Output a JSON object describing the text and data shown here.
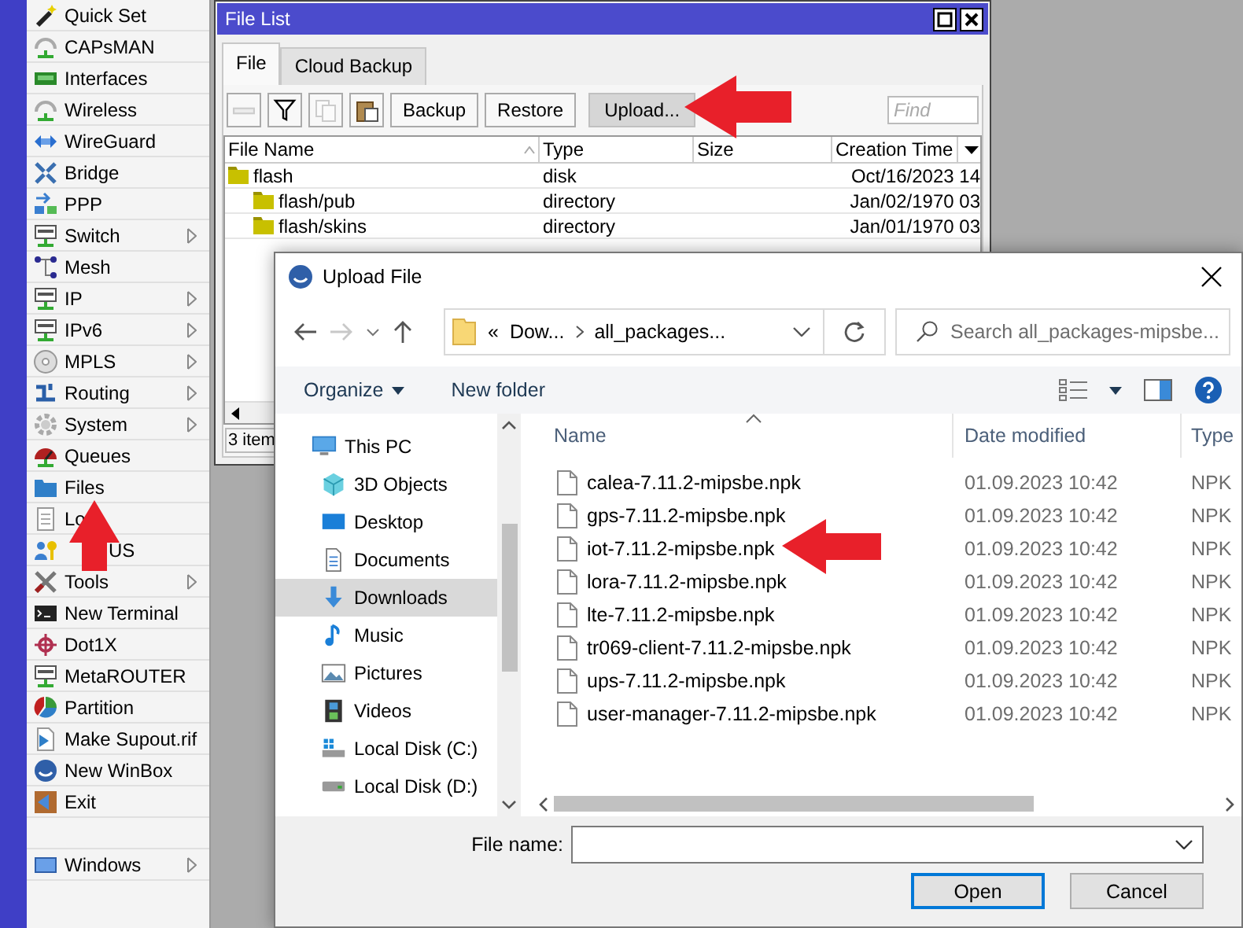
{
  "sidebar": {
    "items": [
      {
        "kind": "item",
        "label": "Quick Set",
        "submenu": false,
        "covered": false
      },
      {
        "kind": "item",
        "label": "CAPsMAN",
        "submenu": false,
        "covered": false
      },
      {
        "kind": "item",
        "label": "Interfaces",
        "submenu": false,
        "covered": false
      },
      {
        "kind": "item",
        "label": "Wireless",
        "submenu": false,
        "covered": false
      },
      {
        "kind": "item",
        "label": "WireGuard",
        "submenu": false,
        "covered": false
      },
      {
        "kind": "item",
        "label": "Bridge",
        "submenu": false,
        "covered": false
      },
      {
        "kind": "item",
        "label": "PPP",
        "submenu": false,
        "covered": false
      },
      {
        "kind": "item",
        "label": "Switch",
        "submenu": true,
        "covered": false
      },
      {
        "kind": "item",
        "label": "Mesh",
        "submenu": false,
        "covered": false
      },
      {
        "kind": "item",
        "label": "IP",
        "submenu": true,
        "covered": false
      },
      {
        "kind": "item",
        "label": "IPv6",
        "submenu": true,
        "covered": false
      },
      {
        "kind": "item",
        "label": "MPLS",
        "submenu": true,
        "covered": false
      },
      {
        "kind": "item",
        "label": "Routing",
        "submenu": true,
        "covered": false
      },
      {
        "kind": "item",
        "label": "System",
        "submenu": true,
        "covered": false
      },
      {
        "kind": "item",
        "label": "Queues",
        "submenu": false,
        "covered": false
      },
      {
        "kind": "item",
        "label": "Files",
        "submenu": false,
        "covered": false
      },
      {
        "kind": "item",
        "label": "Lo",
        "submenu": false,
        "covered": false
      },
      {
        "kind": "item",
        "label": "US",
        "submenu": false,
        "covered": true
      },
      {
        "kind": "item",
        "label": "Tools",
        "submenu": true,
        "covered": false
      },
      {
        "kind": "item",
        "label": "New Terminal",
        "submenu": false,
        "covered": false
      },
      {
        "kind": "item",
        "label": "Dot1X",
        "submenu": false,
        "covered": false
      },
      {
        "kind": "item",
        "label": "MetaROUTER",
        "submenu": false,
        "covered": false
      },
      {
        "kind": "item",
        "label": "Partition",
        "submenu": false,
        "covered": false
      },
      {
        "kind": "item",
        "label": "Make Supout.rif",
        "submenu": false,
        "covered": false
      },
      {
        "kind": "item",
        "label": "New WinBox",
        "submenu": false,
        "covered": false
      },
      {
        "kind": "item",
        "label": "Exit",
        "submenu": false,
        "covered": false
      },
      {
        "kind": "spacer"
      },
      {
        "kind": "item",
        "label": "Windows",
        "submenu": true,
        "covered": false
      }
    ]
  },
  "file_list": {
    "title": "File List",
    "tabs": [
      {
        "label": "File",
        "selected": true
      },
      {
        "label": "Cloud Backup",
        "selected": false
      }
    ],
    "tool_buttons": [
      {
        "kind": "remove",
        "disabled": true
      },
      {
        "kind": "filter",
        "disabled": false
      },
      {
        "kind": "copy",
        "disabled": true
      },
      {
        "kind": "paste",
        "disabled": false
      }
    ],
    "buttons": [
      {
        "label": "Backup",
        "pressed": false
      },
      {
        "label": "Restore",
        "pressed": false
      },
      {
        "label": "Upload...",
        "pressed": true
      }
    ],
    "find": {
      "placeholder": "Find"
    },
    "table": {
      "columns": [
        {
          "label": "File Name",
          "sorted": true
        },
        {
          "label": "Type",
          "sorted": false
        },
        {
          "label": "Size",
          "sorted": false
        },
        {
          "label": "Creation Time",
          "sorted": false
        }
      ],
      "rows": [
        {
          "name": "flash",
          "type": "disk",
          "created": "Oct/16/2023 14",
          "children": [
            {
              "name": "flash/pub",
              "type": "directory",
              "created": "Jan/02/1970 03"
            },
            {
              "name": "flash/skins",
              "type": "directory",
              "created": "Jan/01/1970 03"
            }
          ]
        }
      ]
    },
    "status": "3 item"
  },
  "upload_dialog": {
    "title": "Upload File",
    "address": {
      "overflow": "«",
      "segments": [
        "Dow...",
        "all_packages..."
      ]
    },
    "search": {
      "placeholder": "Search all_packages-mipsbe..."
    },
    "commands": [
      {
        "label": "Organize",
        "menu": true
      },
      {
        "label": "New folder",
        "menu": false
      }
    ],
    "navigation": [
      {
        "label": "This PC",
        "selected": false,
        "children": [
          {
            "label": "3D Objects",
            "selected": false
          },
          {
            "label": "Desktop",
            "selected": false
          },
          {
            "label": "Documents",
            "selected": false
          },
          {
            "label": "Downloads",
            "selected": true
          },
          {
            "label": "Music",
            "selected": false
          },
          {
            "label": "Pictures",
            "selected": false
          },
          {
            "label": "Videos",
            "selected": false
          },
          {
            "label": "Local Disk (C:)",
            "selected": false
          },
          {
            "label": "Local Disk (D:)",
            "selected": false
          }
        ]
      }
    ],
    "files": {
      "columns": [
        {
          "label": "Name",
          "sorted": true
        },
        {
          "label": "Date modified",
          "sorted": false
        },
        {
          "label": "Type",
          "sorted": false
        }
      ],
      "rows": [
        {
          "name": "calea-7.11.2-mipsbe.npk",
          "modified": "01.09.2023 10:42",
          "type": "NPK"
        },
        {
          "name": "gps-7.11.2-mipsbe.npk",
          "modified": "01.09.2023 10:42",
          "type": "NPK"
        },
        {
          "name": "iot-7.11.2-mipsbe.npk",
          "modified": "01.09.2023 10:42",
          "type": "NPK"
        },
        {
          "name": "lora-7.11.2-mipsbe.npk",
          "modified": "01.09.2023 10:42",
          "type": "NPK"
        },
        {
          "name": "lte-7.11.2-mipsbe.npk",
          "modified": "01.09.2023 10:42",
          "type": "NPK"
        },
        {
          "name": "tr069-client-7.11.2-mipsbe.npk",
          "modified": "01.09.2023 10:42",
          "type": "NPK"
        },
        {
          "name": "ups-7.11.2-mipsbe.npk",
          "modified": "01.09.2023 10:42",
          "type": "NPK"
        },
        {
          "name": "user-manager-7.11.2-mipsbe.npk",
          "modified": "01.09.2023 10:42",
          "type": "NPK"
        }
      ]
    },
    "file_name": {
      "label": "File name:"
    },
    "buttons": [
      {
        "label": "Open",
        "default": true
      },
      {
        "label": "Cancel",
        "default": false
      }
    ]
  }
}
